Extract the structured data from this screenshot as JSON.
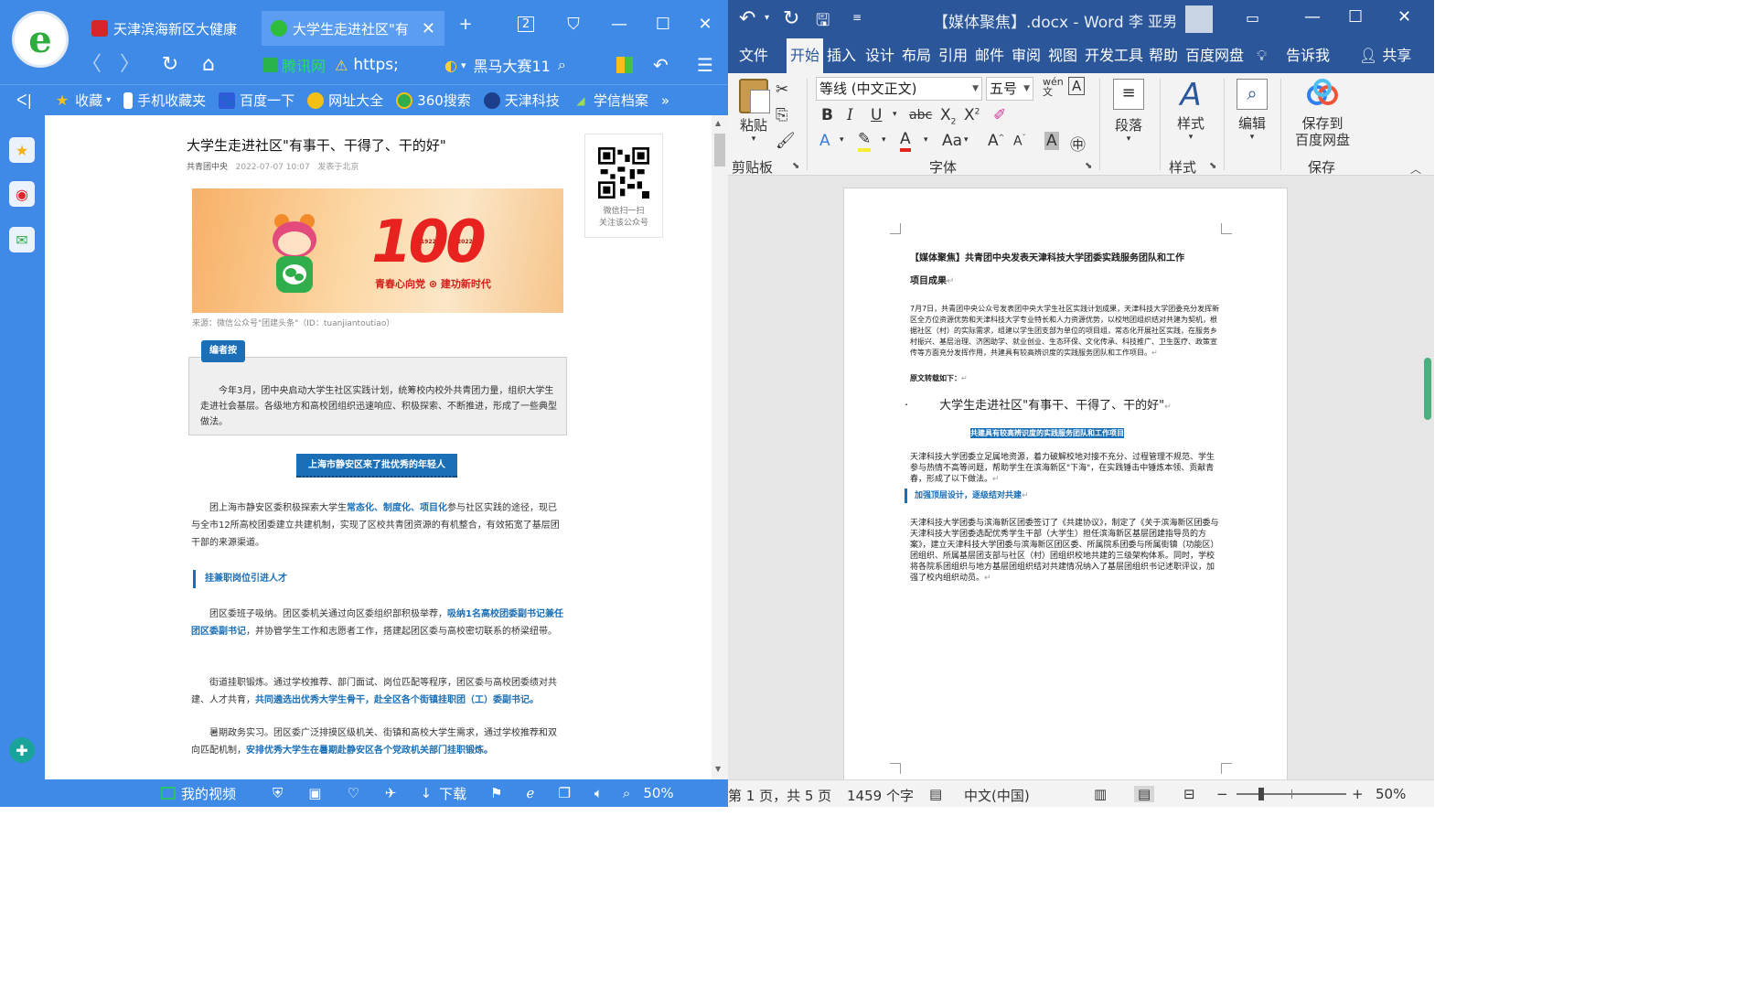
{
  "browser": {
    "tabs": [
      {
        "label": "天津滨海新区大健康",
        "fav_color": "#d6262c"
      },
      {
        "label": "大学生走进社区\"有",
        "fav_color": "#2dbd3a"
      }
    ],
    "tab_count": "2",
    "addr": {
      "site_label": "腾讯网",
      "url": "https;",
      "search_text": "黑马大赛11"
    },
    "bookmarks": {
      "collect": "收藏",
      "items": [
        "手机收藏夹",
        "百度一下",
        "网址大全",
        "360搜索",
        "天津科技",
        "学信档案"
      ]
    },
    "status": {
      "video": "我的视频",
      "download": "下载",
      "zoom": "50%"
    },
    "article": {
      "title": "大学生走进社区\"有事干、干得了、干的好\"",
      "source": "共青团中央",
      "date": "2022-07-07 10:07",
      "location": "发表于北京",
      "qr_caption_1": "微信扫一扫",
      "qr_caption_2": "关注该公众号",
      "banner_number": "100",
      "banner_year_left": "1922",
      "banner_year_right": "2022",
      "banner_slogan": "青春心向党 ⊛ 建功新时代",
      "caption": "来源：微信公众号\"团建头条\"（ID：tuanjiantoutiao）",
      "editor_tag": "编者按",
      "editor_text": "今年3月，团中央启动大学生社区实践计划，统筹校内校外共青团力量，组织大学生走进社会基层。各级地方和高校团组织迅速响应、积极探索、不断推进，形成了一些典型做法。",
      "section_btn": "上海市静安区来了批优秀的年轻人",
      "p1_a": "团上海市静安区委积极探索大学生",
      "p1_hl": "常态化、制度化、项目化",
      "p1_b": "参与社区实践的途径，现已与全市12所高校团委建立共建机制，实现了区校共青团资源的有机整合，有效拓宽了基层团干部的来源渠道。",
      "subhead": "挂兼职岗位引进人才",
      "p2_a": "团区委班子吸纳。团区委机关通过向区委组织部积极举荐，",
      "p2_hl": "吸纳1名高校团委副书记兼任团区委副书记",
      "p2_b": "，并协管学生工作和志愿者工作，搭建起团区委与高校密切联系的桥梁纽带。",
      "p3_a": "街道挂职锻炼。通过学校推荐、部门面试、岗位匹配等程序，团区委与高校团委绩对共建、人才共育，",
      "p3_hl": "共同遴选出优秀大学生骨干，赴全区各个街镇挂职团（工）委副书记。",
      "p4_a": "暑期政务实习。团区委广泛排摸区级机关、街镇和高校大学生需求，通过学校推荐和双向匹配机制，",
      "p4_hl": "安排优秀大学生在暑期赴静安区各个党政机关部门挂职锻炼。"
    }
  },
  "word": {
    "title": "【媒体聚焦】.docx  -  Word",
    "user": "李 亚男",
    "menu": [
      "文件",
      "开始",
      "插入",
      "设计",
      "布局",
      "引用",
      "邮件",
      "审阅",
      "视图",
      "开发工具",
      "帮助",
      "百度网盘"
    ],
    "tell_me": "告诉我",
    "share": "共享",
    "ribbon": {
      "paste": "粘贴",
      "clipboard": "剪贴板",
      "font_name": "等线 (中文正文)",
      "font_size": "五号",
      "font_group": "字体",
      "paragraph": "段落",
      "styles": "样式",
      "styles_group": "样式",
      "editing": "编辑",
      "save_baidu_1": "保存到",
      "save_baidu_2": "百度网盘",
      "save_group": "保存"
    },
    "doc": {
      "heading_1": "【媒体聚焦】共青团中央发表天津科技大学团委实践服务团队和工作",
      "heading_2": "项目成果",
      "intro": "7月7日，共青团中央公众号发表团中央大学生社区实践计划成果，天津科技大学团委充分发挥新区全方位资源优势和天津科技大学专业特长和人力资源优势，以校地团组织结对共建为契机，根据社区（村）的实际需求，组建以学生团支部为单位的项目组，常态化开展社区实践，在服务乡村振兴、基层治理、济困助学、就业创业、生态环保、文化传承、科技推广、卫生医疗、政策宣传等方面充分发挥作用，共建具有较高辨识度的实践服务团队和工作项目。",
      "reprint": "原文转载如下：",
      "article_title": "大学生走进社区\"有事干、干得了、干的好\"",
      "highlight": "共建具有较高辨识度的实践服务团队和工作项目",
      "p1": "天津科技大学团委立足属地资源，着力破解校地对接不充分、过程管理不规范、学生参与热情不高等问题，帮助学生在滨海新区\"下海\"，在实践锤击中锤炼本领、贡献青春，形成了以下做法。",
      "subhead": "加强顶层设计，逐级结对共建",
      "p2": "天津科技大学团委与滨海新区团委签订了《共建协议》，制定了《关于滨海新区团委与天津科技大学团委选配优秀学生干部（大学生）担任滨海新区基层团建指导员的方案》，建立天津科技大学团委与滨海新区团区委、所属院系团委与所属街镇（功能区）团组织、所属基层团支部与社区（村）团组织校地共建的三级架构体系。同时，学校将各院系团组织与地方基层团组织结对共建情况纳入了基层团组织书记述职评议，加强了校内组织动员。"
    },
    "status": {
      "page": "第 1 页，共 5 页",
      "words": "1459 个字",
      "lang": "中文(中国)",
      "zoom": "50%"
    }
  }
}
